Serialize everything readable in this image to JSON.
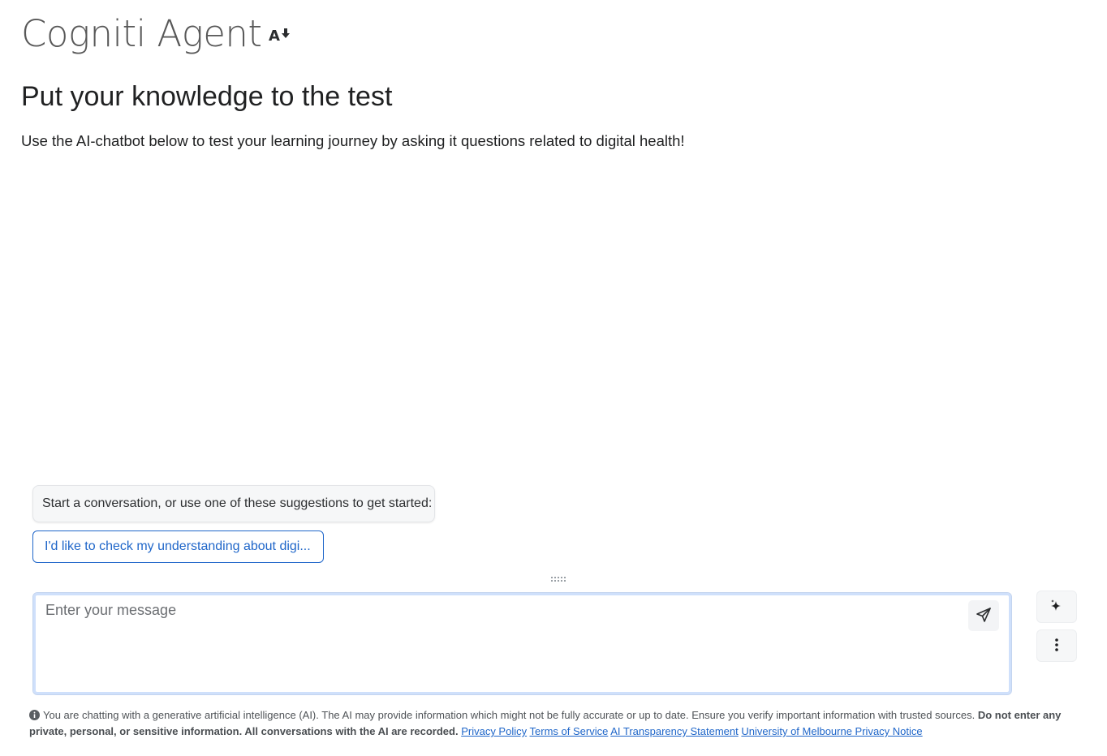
{
  "app": {
    "title": "Cogniti Agent",
    "title_icon": "text-size-down-icon"
  },
  "page": {
    "heading": "Put your knowledge to the test",
    "intro": "Use the AI-chatbot below to test your learning journey by asking it questions related to digital health!"
  },
  "chat": {
    "suggestions_header": "Start a conversation, or use one of these suggestions to get started:",
    "suggestions": [
      {
        "label": "I'd like to check my understanding about digi..."
      }
    ],
    "input_placeholder": "Enter your message",
    "input_value": "",
    "send_icon": "send-icon",
    "ai_icon": "sparkles-icon",
    "more_icon": "more-vertical-icon",
    "accent_color": "#1f66c9"
  },
  "disclaimer": {
    "icon": "info-icon",
    "text": "You are chatting with a generative artificial intelligence (AI). The AI may provide information which might not be fully accurate or up to date. Ensure you verify important information with trusted sources.",
    "warning": "Do not enter any private, personal, or sensitive information. All conversations with the AI are recorded.",
    "links": [
      {
        "label": "Privacy Policy"
      },
      {
        "label": "Terms of Service"
      },
      {
        "label": "AI Transparency Statement"
      },
      {
        "label": "University of Melbourne Privacy Notice"
      }
    ]
  }
}
